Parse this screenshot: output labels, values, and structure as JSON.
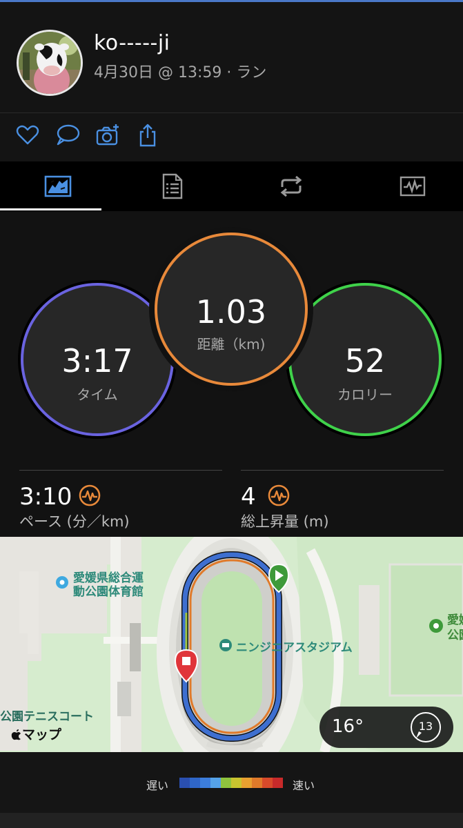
{
  "header": {
    "username": "ko-----ji",
    "subtitle": "4月30日 @ 13:59 · ラン"
  },
  "actions": [
    "heart-icon",
    "comment-icon",
    "add-photo-icon",
    "share-icon"
  ],
  "tabs": [
    {
      "name": "overview",
      "icon": "map-chart-icon",
      "active": true
    },
    {
      "name": "details",
      "icon": "document-list-icon",
      "active": false
    },
    {
      "name": "laps",
      "icon": "repeat-icon",
      "active": false
    },
    {
      "name": "charts",
      "icon": "graph-icon",
      "active": false
    }
  ],
  "stats": {
    "time": {
      "value": "3:17",
      "label": "タイム",
      "color": "#6a63e0"
    },
    "distance": {
      "value": "1.03",
      "label": "距離（km)",
      "color": "#e8893a"
    },
    "calories": {
      "value": "52",
      "label": "カロリー",
      "color": "#3fd24a"
    }
  },
  "metrics": {
    "pace": {
      "value": "3:10",
      "label": "ペース (分／km)",
      "icon": "pulse-icon"
    },
    "ascent": {
      "value": "4",
      "label": "総上昇量 (m)",
      "icon": "pulse-icon"
    }
  },
  "map": {
    "labels": {
      "gym": "愛媛県総合運\n動公園体育館",
      "stadium": "ニンジニアスタジアム",
      "tennis": "公園テニスコート",
      "right_edge": "愛媛\n公園",
      "apple_maps": "マップ"
    },
    "weather": {
      "temp": "16°",
      "wind": "13"
    }
  },
  "legend": {
    "slow": "遅い",
    "fast": "速い",
    "colors": [
      "#2a4fb0",
      "#2f66c8",
      "#3c7ddc",
      "#55a2e8",
      "#8fc43e",
      "#c9c42f",
      "#e8a030",
      "#e07a2a",
      "#d84a2a",
      "#c82a2a"
    ]
  }
}
